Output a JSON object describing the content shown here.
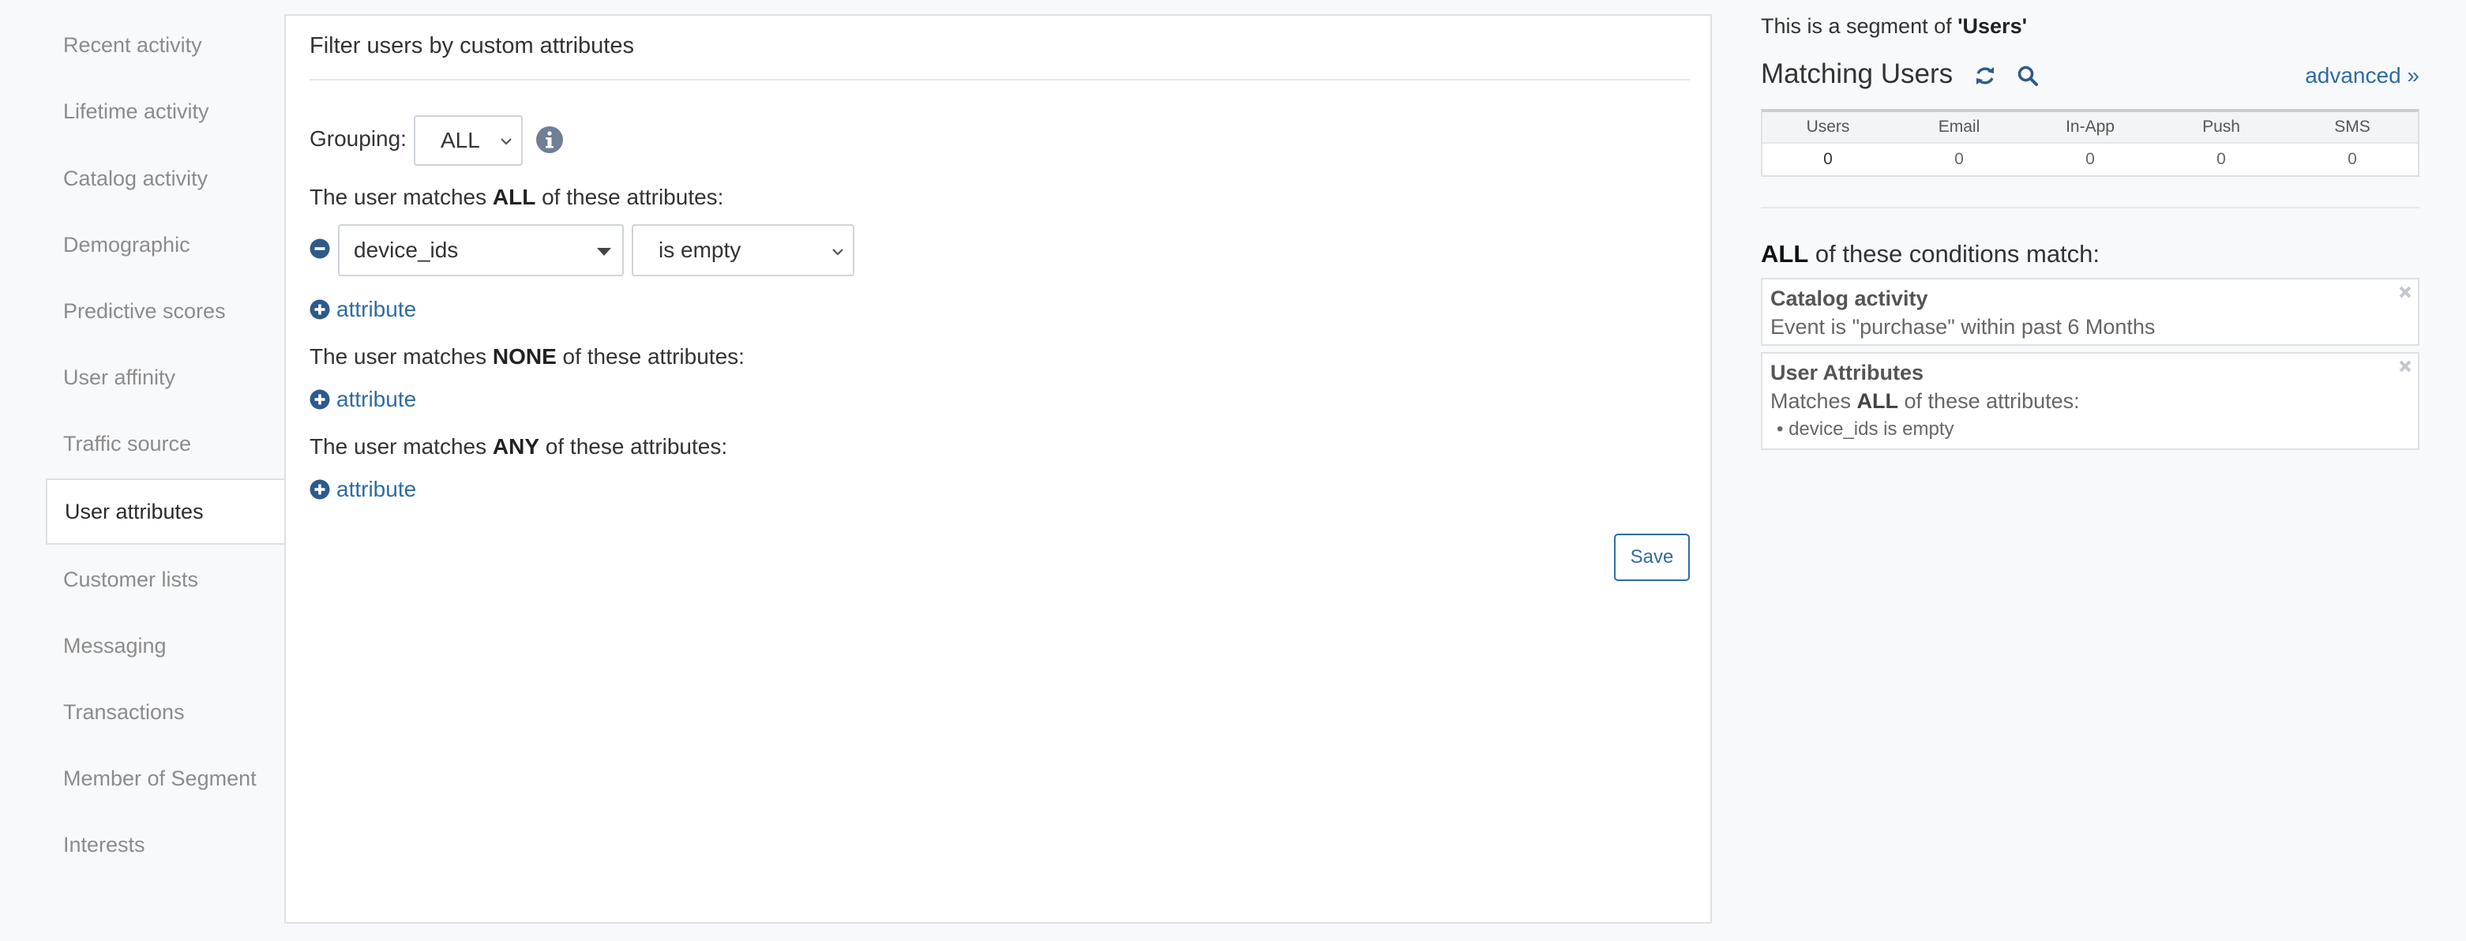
{
  "sidebar": {
    "items": [
      {
        "label": "Recent activity",
        "active": false
      },
      {
        "label": "Lifetime activity",
        "active": false
      },
      {
        "label": "Catalog activity",
        "active": false
      },
      {
        "label": "Demographic",
        "active": false
      },
      {
        "label": "Predictive scores",
        "active": false
      },
      {
        "label": "User affinity",
        "active": false
      },
      {
        "label": "Traffic source",
        "active": false
      },
      {
        "label": "User attributes",
        "active": true
      },
      {
        "label": "Customer lists",
        "active": false
      },
      {
        "label": "Messaging",
        "active": false
      },
      {
        "label": "Transactions",
        "active": false
      },
      {
        "label": "Member of Segment",
        "active": false
      },
      {
        "label": "Interests",
        "active": false
      }
    ]
  },
  "filter": {
    "title": "Filter users by custom attributes",
    "grouping_label": "Grouping:",
    "grouping_value": "ALL",
    "all_rule": {
      "prefix": "The user matches ",
      "keyword": "ALL",
      "suffix": " of these attributes:"
    },
    "condition": {
      "attribute": "device_ids",
      "operator": "is empty"
    },
    "none_rule": {
      "prefix": "The user matches ",
      "keyword": "NONE",
      "suffix": " of these attributes:"
    },
    "any_rule": {
      "prefix": "The user matches ",
      "keyword": "ANY",
      "suffix": " of these attributes:"
    },
    "add_attribute_label": "attribute",
    "save_label": "Save"
  },
  "segment": {
    "note_prefix": "This is a segment of ",
    "note_name": "'Users'",
    "matching_title": "Matching Users",
    "advanced_label": "advanced »",
    "stats_headers": [
      "Users",
      "Email",
      "In-App",
      "Push",
      "SMS"
    ],
    "stats_values": [
      "0",
      "0",
      "0",
      "0",
      "0"
    ],
    "conditions_keyword": "ALL",
    "conditions_suffix": " of these conditions match:",
    "conditions": [
      {
        "title": "Catalog activity",
        "desc": "Event is \"purchase\" within past 6 Months"
      },
      {
        "title": "User Attributes",
        "desc_prefix": "Matches ",
        "desc_keyword": "ALL",
        "desc_suffix": " of these attributes:",
        "bullet": "• device_ids is empty"
      }
    ]
  },
  "colors": {
    "accent": "#2e6ca4",
    "icon": "#2e5a8a",
    "border": "#dde1e6"
  }
}
